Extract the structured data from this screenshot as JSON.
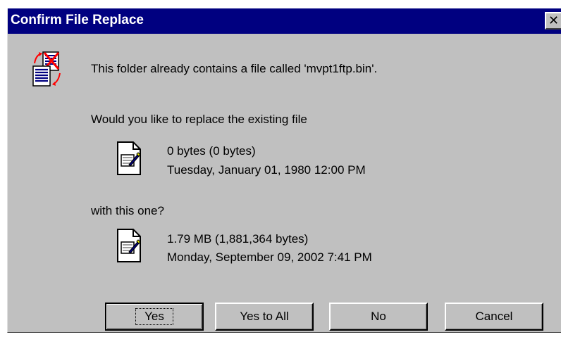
{
  "window": {
    "title": "Confirm File Replace",
    "close_glyph": "✕"
  },
  "message": {
    "line1": "This folder already contains a file called 'mvpt1ftp.bin'.",
    "line2": "Would you like to replace the existing file",
    "line3": "with this one?"
  },
  "existing_file": {
    "size": "0 bytes (0 bytes)",
    "date": "Tuesday, January 01, 1980 12:00 PM",
    "icon": "document-icon"
  },
  "new_file": {
    "size": "1.79 MB (1,881,364 bytes)",
    "date": "Monday, September 09, 2002 7:41 PM",
    "icon": "document-icon"
  },
  "buttons": {
    "yes": "Yes",
    "yes_to_all": "Yes to All",
    "no": "No",
    "cancel": "Cancel"
  },
  "colors": {
    "titlebar": "#000080",
    "face": "#c0c0c0"
  }
}
